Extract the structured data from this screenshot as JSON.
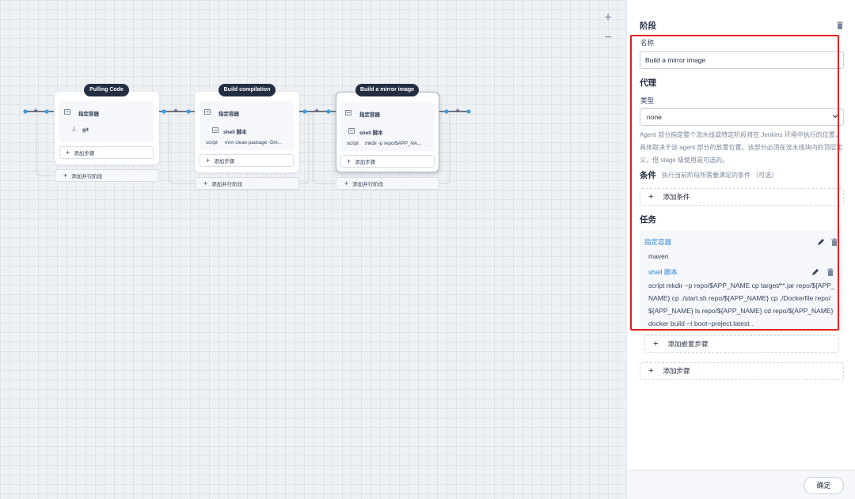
{
  "canvas": {
    "zoom_in": "+",
    "zoom_out": "−",
    "stages": [
      {
        "name": "Pulling Code",
        "steps": [
          {
            "title": "指定容器"
          },
          {
            "title": "git"
          }
        ],
        "add_step": "添加步骤",
        "add_parallel": "添加并行阶段"
      },
      {
        "name": "Build compilation",
        "steps": [
          {
            "title": "指定容器"
          },
          {
            "title": "shell 脚本",
            "script_label": "script",
            "script": "mvn clean package -Dm..."
          }
        ],
        "add_step": "添加步骤",
        "add_parallel": "添加并行阶段"
      },
      {
        "name": "Build a mirror image",
        "steps": [
          {
            "title": "指定容器"
          },
          {
            "title": "shell 脚本",
            "script_label": "script",
            "script": "mkdir -p repo/$APP_NA..."
          }
        ],
        "add_step": "添加步骤",
        "add_parallel": "添加并行阶段"
      }
    ]
  },
  "panel": {
    "title": "阶段",
    "name_label": "名称",
    "name_value": "Build a mirror image",
    "agent_heading": "代理",
    "type_label": "类型",
    "type_value": "none",
    "agent_desc": "Agent 部分指定整个流水线或特定阶段将在 Jenkins 环境中执行的位置， 具体取决于该 agent 部分的放置位置。该部分必须在流水线块内的顶层定义，但 stage 级使用是可选的。",
    "condition_heading": "条件",
    "condition_sub": "执行当前阶段所需要满足的条件 （可选）",
    "add_condition": "添加条件",
    "task_heading": "任务",
    "container_title": "指定容器",
    "container_value": "maven",
    "shell_title": "shell 脚本",
    "shell_script": "script   mkdir −p repo/$APP_NAME cp target/**.jar repo/${APP_NAME} cp ./start.sh repo/${APP_NAME} cp ./Dockerfile repo/${APP_NAME} ls repo/${APP_NAME} cd repo/${APP_NAME} docker build −t boot−preject:latest .",
    "add_nested_step": "添加嵌套步骤",
    "add_step": "添加步骤",
    "confirm": "确定"
  },
  "colors": {
    "accent_blue": "#3385d6",
    "dark_pill": "#242e42",
    "highlight_red": "#e02020",
    "connector_blue": "#3d9ce0"
  }
}
